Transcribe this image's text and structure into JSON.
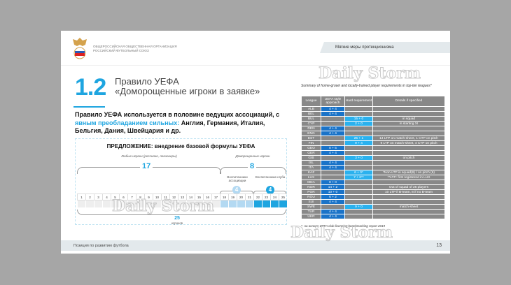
{
  "header": {
    "org_line1": "ОБЩЕРОССИЙСКАЯ ОБЩЕСТВЕННАЯ ОРГАНИЗАЦИЯ",
    "org_line2": "РОССИЙСКИЙ ФУТБОЛЬНЫЙ СОЮЗ",
    "section_tag": "Мягкие меры протекционизма"
  },
  "title": {
    "number": "1.2",
    "line1": "Правило УЕФА",
    "line2": "«Доморощенные игроки в заявке»"
  },
  "description": {
    "part1": "Правило УЕФА используется в половине ведущих ассоциаций, с ",
    "highlight": "явным преобладанием сильных:",
    "part2": " Англия, Германия, Италия, Бельгия, Дания, Швейцария и др."
  },
  "diagram": {
    "title": "ПРЕДЛОЖЕНИЕ: внедрение базовой формулы УЕФА",
    "any_label": "Любые игроки (россияне, легионеры)",
    "any_count": "17",
    "homegrown_label": "Доморощенные игроки",
    "homegrown_count": "8",
    "assoc_label": "Воспитанники ассоциации",
    "assoc_count": "4",
    "club_label": "Воспитанники клуба",
    "club_count": "4",
    "total_count": "25",
    "total_label": "игроков",
    "cells": [
      "1",
      "2",
      "3",
      "4",
      "5",
      "6",
      "7",
      "8",
      "9",
      "10",
      "11",
      "12",
      "13",
      "14",
      "15",
      "16",
      "17",
      "18",
      "19",
      "20",
      "21",
      "22",
      "23",
      "24",
      "25"
    ]
  },
  "table": {
    "caption": "Summary of home-grown and locally-trained player requirements in top-tier leagues*",
    "headers": [
      "League",
      "UEFA style approach",
      "Hard requirement",
      "Details if specified"
    ],
    "rows": [
      [
        "ALB",
        "4 + 4",
        "",
        ""
      ],
      [
        "BEL",
        "4 + 4",
        "",
        ""
      ],
      [
        "BUL",
        "",
        "15 + 0",
        "in squad"
      ],
      [
        "CYP",
        "",
        "2 + 0",
        "in starting XI"
      ],
      [
        "DEN",
        "4 + 4",
        "",
        ""
      ],
      [
        "ENG",
        "4 + 4",
        "",
        ""
      ],
      [
        "EST",
        "",
        "25 + 1",
        "14 LTP on match-sheet, 1 CTP on pitch"
      ],
      [
        "FIN",
        "",
        "9 + 4",
        "9 LTP on match-sheet, 4 CTP on pitch"
      ],
      [
        "GEO",
        "0 + 5",
        "",
        ""
      ],
      [
        "GER",
        "4 + 4",
        "",
        ""
      ],
      [
        "GIB",
        "",
        "3 + 0",
        "on pitch"
      ],
      [
        "ISL",
        "4 + 4",
        "",
        ""
      ],
      [
        "ITA",
        "4 + 4",
        "",
        ""
      ],
      [
        "KAZ",
        "",
        "6 + 0*",
        "*Non-LTP in squad(6) / on pitch (6)"
      ],
      [
        "LUX",
        "",
        "7 + 0**",
        "**LTP: first registered in LUX"
      ],
      [
        "MDA",
        "8 + 0",
        "",
        ""
      ],
      [
        "NOR",
        "14 + 2",
        "",
        "Out of squad of 25 players"
      ],
      [
        "POR",
        "10 + 0",
        "",
        "10 LTP if B-team, 8 if no B-team"
      ],
      [
        "ROU",
        "6 + 2",
        "",
        ""
      ],
      [
        "SUI",
        "4 + 4",
        "",
        ""
      ],
      [
        "SWE",
        "",
        "9 + 0",
        "match-sheet"
      ],
      [
        "TUR",
        "4 + 4",
        "",
        ""
      ],
      [
        "UKR",
        "4 + 4",
        "",
        ""
      ]
    ],
    "note": "*- на основе UEFA club licensing benchmarking report 2019"
  },
  "footer": {
    "text": "Позиция по развитию футбола",
    "page": "13"
  },
  "watermark": "Daily Storm",
  "colors": {
    "accent": "#1ea5e0",
    "uefa_cell": "#1a73c8",
    "hard_cell": "#2ab1ee",
    "table_gray": "#888888"
  }
}
